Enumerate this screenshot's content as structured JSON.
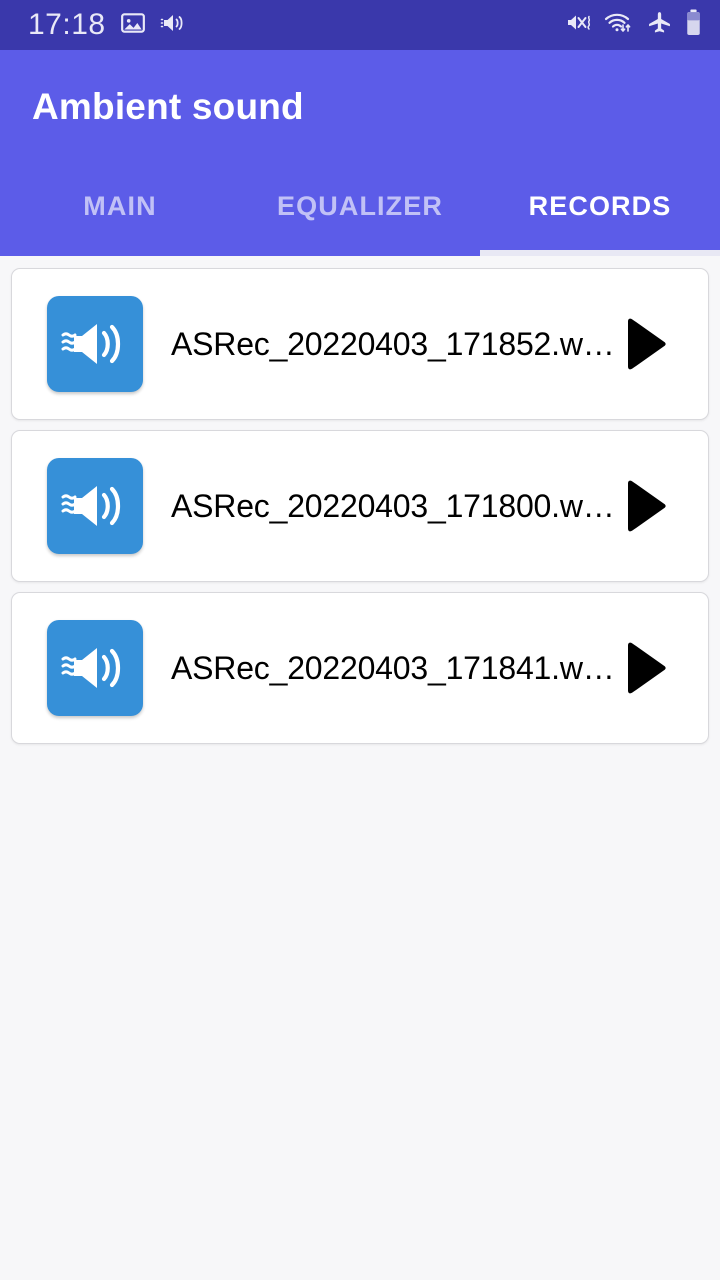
{
  "status_bar": {
    "time": "17:18",
    "left_icons": [
      "image-icon",
      "volume-icon"
    ],
    "right_icons": [
      "mute-vibrate-icon",
      "wifi-icon",
      "airplane-mode-icon",
      "battery-icon"
    ],
    "background_color": "#3a38ab"
  },
  "app_bar": {
    "title": "Ambient sound",
    "background_color": "#5c5ce8",
    "title_color": "#ffffff"
  },
  "tabs": {
    "active_index": 2,
    "indicator_color": "#e8e8f4",
    "items": [
      {
        "label": "MAIN",
        "active": false
      },
      {
        "label": "EQUALIZER",
        "active": false
      },
      {
        "label": "RECORDS",
        "active": true
      }
    ]
  },
  "records": {
    "icon_color": "#3690d8",
    "play_icon_color": "#000000",
    "items": [
      {
        "filename": "ASRec_20220403_171852.w…",
        "icon": "speaker-waves-icon",
        "action": "play-icon"
      },
      {
        "filename": "ASRec_20220403_171800.w…",
        "icon": "speaker-waves-icon",
        "action": "play-icon"
      },
      {
        "filename": "ASRec_20220403_171841.w…",
        "icon": "speaker-waves-icon",
        "action": "play-icon"
      }
    ]
  },
  "page_background": "#f7f7f9"
}
